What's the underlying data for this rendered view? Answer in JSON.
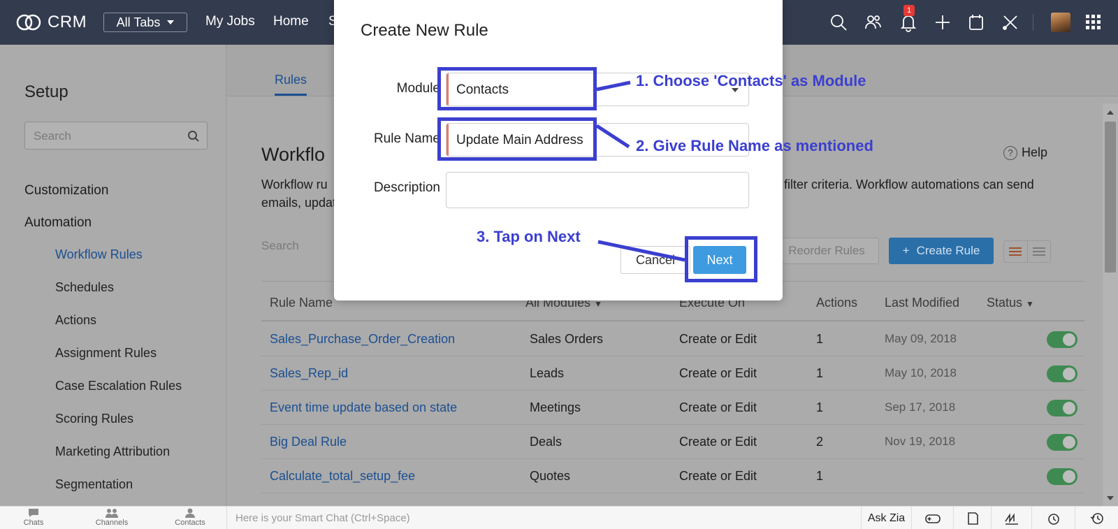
{
  "topbar": {
    "app_name": "CRM",
    "all_tabs": "All Tabs",
    "nav": [
      "My Jobs",
      "Home",
      "S"
    ],
    "notification_count": "1"
  },
  "sidebar": {
    "title": "Setup",
    "search_placeholder": "Search",
    "sections": [
      "Customization",
      "Automation"
    ],
    "items": [
      {
        "label": "Workflow Rules",
        "active": true
      },
      {
        "label": "Schedules"
      },
      {
        "label": "Actions"
      },
      {
        "label": "Assignment Rules"
      },
      {
        "label": "Case Escalation Rules"
      },
      {
        "label": "Scoring Rules"
      },
      {
        "label": "Marketing Attribution"
      },
      {
        "label": "Segmentation"
      }
    ]
  },
  "main": {
    "tab": "Rules",
    "title": "Workflo",
    "desc_line1": "Workflow ru",
    "desc_line2": "emails, updat",
    "desc_right": "filter criteria. Workflow automations can send",
    "help": "Help",
    "search_placeholder": "Search",
    "reorder": "Reorder Rules",
    "create": "Create Rule",
    "columns": [
      "Rule Name",
      "All Modules",
      "Execute On",
      "Actions",
      "Last Modified",
      "Status"
    ],
    "rows": [
      {
        "name": "Sales_Purchase_Order_Creation",
        "module": "Sales Orders",
        "execute": "Create or Edit",
        "actions": "1",
        "modified": "May 09, 2018"
      },
      {
        "name": "Sales_Rep_id",
        "module": "Leads",
        "execute": "Create or Edit",
        "actions": "1",
        "modified": "May 10, 2018"
      },
      {
        "name": "Event time update based on state",
        "module": "Meetings",
        "execute": "Create or Edit",
        "actions": "1",
        "modified": "Sep 17, 2018"
      },
      {
        "name": "Big Deal Rule",
        "module": "Deals",
        "execute": "Create or Edit",
        "actions": "2",
        "modified": "Nov 19, 2018"
      },
      {
        "name": "Calculate_total_setup_fee",
        "module": "Quotes",
        "execute": "Create or Edit",
        "actions": "1",
        "modified": ""
      }
    ]
  },
  "modal": {
    "title": "Create New Rule",
    "module_label": "Module",
    "module_value": "Contacts",
    "rule_name_label": "Rule Name",
    "rule_name_value": "Update Main Address",
    "description_label": "Description",
    "description_value": "",
    "cancel": "Cancel",
    "next": "Next"
  },
  "annotations": {
    "step1": "1. Choose 'Contacts' as Module",
    "step2": "2. Give Rule Name as mentioned",
    "step3": "3. Tap on Next",
    "color": "#3b3fcf"
  },
  "bottombar": {
    "items": [
      "Chats",
      "Channels",
      "Contacts"
    ],
    "chat_placeholder": "Here is your Smart Chat (Ctrl+Space)",
    "ask_zia": "Ask Zia"
  },
  "colors": {
    "topbar": "#333b4e",
    "link": "#1b4f91",
    "primary_button": "#3e9be0",
    "toggle_on": "#3f8a52"
  }
}
